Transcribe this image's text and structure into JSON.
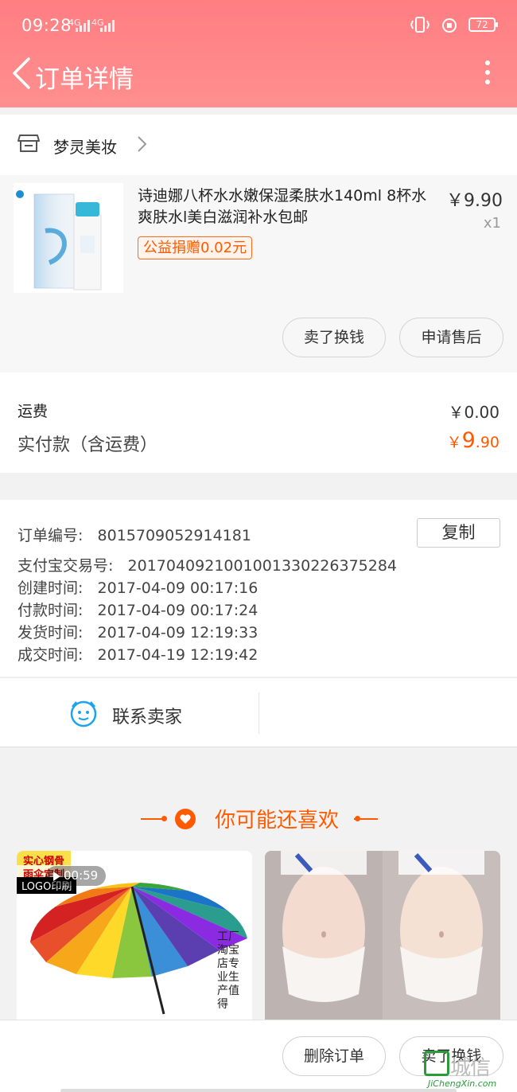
{
  "status_bar": {
    "time": "09:28",
    "net1": "4G",
    "net2": "4G",
    "battery": "72"
  },
  "header": {
    "title": "订单详情"
  },
  "store": {
    "name": "梦灵美妆"
  },
  "product": {
    "title": "诗迪娜八杯水水嫩保湿柔肤水140ml 8杯水爽肤水l美白滋润补水包邮",
    "price": "￥9.90",
    "quantity": "x1",
    "charity_tag": "公益捐赠0.02元",
    "actions": [
      "卖了换钱",
      "申请售后"
    ]
  },
  "fees": {
    "shipping_label": "运费",
    "shipping_value": "￥0.00",
    "paid_label": "实付款（含运费）",
    "paid_currency": "￥",
    "paid_int": "9",
    "paid_dec": ".90"
  },
  "order_info": {
    "copy_label": "复制",
    "rows": [
      {
        "label": "订单编号:",
        "value": "8015709052914181"
      },
      {
        "label": "支付宝交易号:",
        "value": "2017040921001001330226375284"
      },
      {
        "label": "创建时间:",
        "value": "2017-04-09 00:17:16"
      },
      {
        "label": "付款时间:",
        "value": "2017-04-09 00:17:24"
      },
      {
        "label": "发货时间:",
        "value": "2017-04-09 12:19:33"
      },
      {
        "label": "成交时间:",
        "value": "2017-04-19 12:19:42"
      }
    ]
  },
  "contact": {
    "label": "联系卖家"
  },
  "recommend": {
    "title": "你可能还喜欢",
    "card_a": {
      "badge1": "实心钢骨",
      "badge2": "雨伞定制",
      "badge3": "LOGO印刷",
      "video_time": "00:59",
      "calligraphy": "工厂淘宝店专业生产值得"
    }
  },
  "bottom_bar": {
    "delete_label": "删除订单",
    "sell_label": "卖了换钱"
  },
  "watermark": {
    "text": "城信",
    "url": "JiChengXin.com"
  }
}
